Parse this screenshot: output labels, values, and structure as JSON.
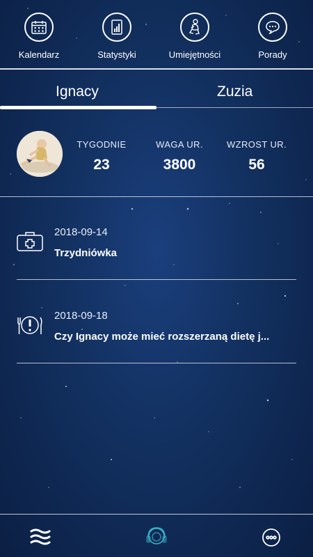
{
  "nav": {
    "items": [
      {
        "label": "Kalendarz",
        "icon": "calendar-icon"
      },
      {
        "label": "Statystyki",
        "icon": "chart-icon"
      },
      {
        "label": "Umiejętności",
        "icon": "baby-skill-icon"
      },
      {
        "label": "Porady",
        "icon": "speech-bubble-icon"
      }
    ]
  },
  "tabs": [
    {
      "label": "Ignacy",
      "active": true
    },
    {
      "label": "Zuzia",
      "active": false
    }
  ],
  "profile": {
    "stats": [
      {
        "label": "TYGODNIE",
        "value": "23"
      },
      {
        "label": "WAGA UR.",
        "value": "3800"
      },
      {
        "label": "WZROST UR.",
        "value": "56"
      }
    ]
  },
  "entries": [
    {
      "date": "2018-09-14",
      "title": "Trzydniówka",
      "icon": "medical-kit-icon"
    },
    {
      "date": "2018-09-18",
      "title": "Czy Ignacy może mieć rozszerzaną dietę j...",
      "icon": "alert-plate-icon"
    }
  ],
  "bottom_bar": {
    "icons": [
      "menu-waves-icon",
      "headset-icon",
      "more-dots-icon"
    ]
  },
  "colors": {
    "background": "#12305f",
    "accent_icon": "#3ab0c7"
  }
}
